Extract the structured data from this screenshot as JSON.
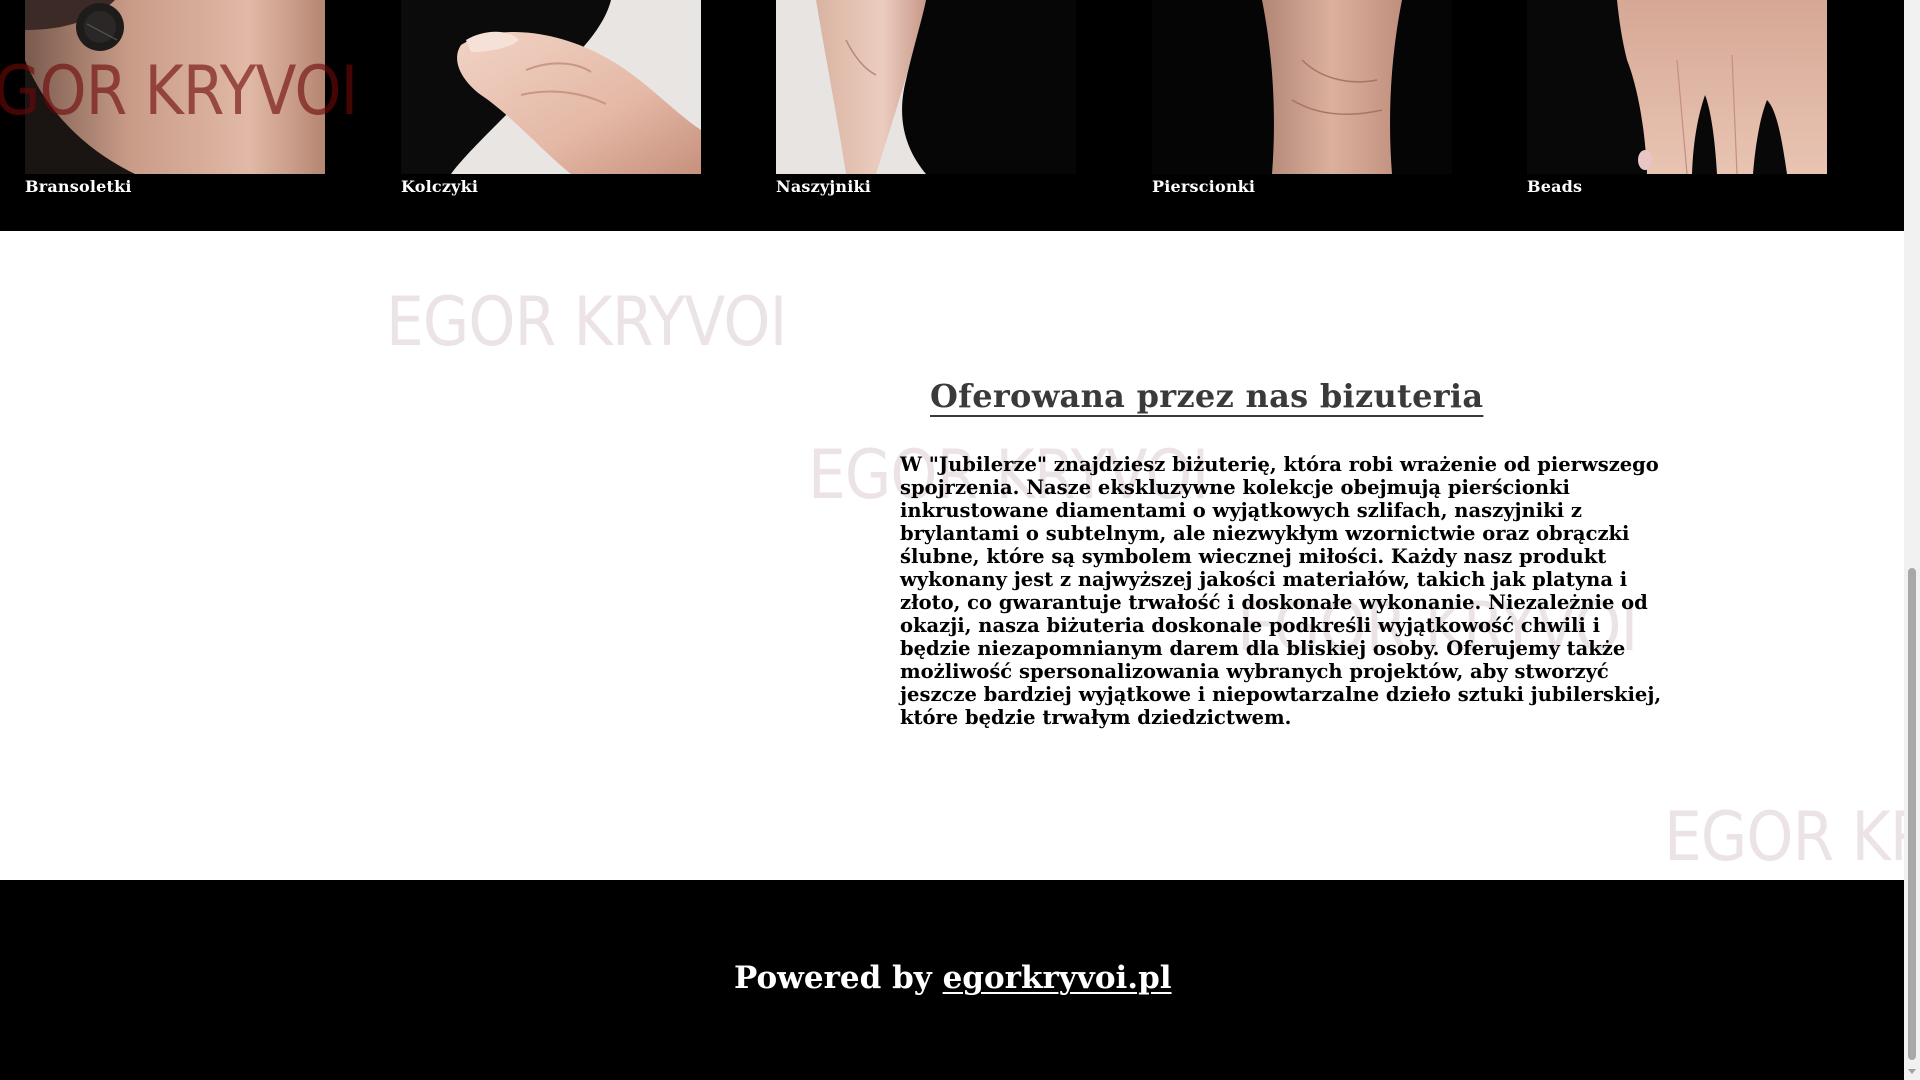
{
  "categories": [
    {
      "label": "Bransoletki",
      "image": "model-wrist-bracelet-photo"
    },
    {
      "label": "Kolczyki",
      "image": "model-hand-at-shoulder-photo"
    },
    {
      "label": "Naszyjniki",
      "image": "model-arm-black-top-photo"
    },
    {
      "label": "Pierscionki",
      "image": "model-arm-black-top-photo"
    },
    {
      "label": "Beads",
      "image": "model-hand-fingers-photo"
    }
  ],
  "watermark_text": "EGOR KRYVOI",
  "watermark_partial_top": "GOR KRYVOI",
  "watermark_partial_right": "EGOR KR",
  "section": {
    "heading": "Oferowana przez nas bizuteria",
    "body": "W \"Jubilerze\" znajdziesz biżuterię, która robi wrażenie od pierwszego spojrzenia. Nasze ekskluzywne kolekcje obejmują pierścionki inkrustowane diamentami o wyjątkowych szlifach, naszyjniki z brylantami o subtelnym, ale niezwykłym wzornictwie oraz obrączki ślubne, które są symbolem wiecznej miłości. Każdy nasz produkt wykonany jest z najwyższej jakości materiałów, takich jak platyna i złoto, co gwarantuje trwałość i doskonałe wykonanie. Niezależnie od okazji, nasza biżuteria doskonale podkreśli wyjątkowość chwili i będzie niezapomnianym darem dla bliskiej osoby. Oferujemy także możliwość spersonalizowania wybranych projektów, aby stworzyć jeszcze bardziej wyjątkowe i niepowtarzalne dzieło sztuki jubilerskiej, które będzie trwałym dziedzictwem."
  },
  "footer": {
    "prefix": "Powered by ",
    "link_text": "egorkryvoi.pl"
  },
  "colors": {
    "background": "#ffffff",
    "strip_background": "#000000",
    "footer_background": "#000000",
    "heading_text": "#3a3a3a",
    "body_text": "#000000",
    "watermark_light": "#e6dfe1",
    "watermark_dark": "#6e0808"
  }
}
